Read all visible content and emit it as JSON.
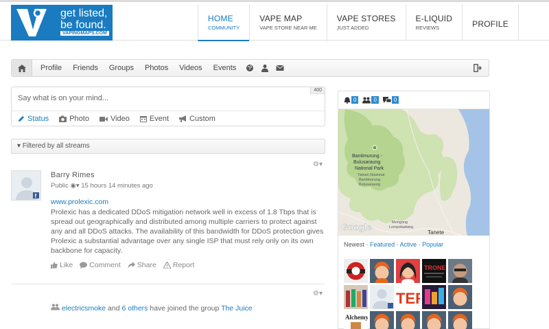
{
  "logo": {
    "tagline_line1": "get listed,",
    "tagline_line2": "be found.",
    "url": "VAPINGMAPS.COM"
  },
  "nav": [
    {
      "main": "HOME",
      "sub": "COMMUNITY"
    },
    {
      "main": "VAPE MAP",
      "sub": "VAPE STORE NEAR ME"
    },
    {
      "main": "VAPE STORES",
      "sub": "JUST ADDED"
    },
    {
      "main": "E-LIQUID",
      "sub": "REVIEWS"
    },
    {
      "main": "PROFILE",
      "sub": ""
    }
  ],
  "toolbar": {
    "links": [
      "Profile",
      "Friends",
      "Groups",
      "Photos",
      "Videos",
      "Events"
    ],
    "icons": [
      "home-icon",
      "globe-icon",
      "user-icon",
      "envelope-icon",
      "logout-icon"
    ]
  },
  "composer": {
    "placeholder": "Say what is on your mind...",
    "counter": "400",
    "tabs": [
      "Status",
      "Photo",
      "Video",
      "Event",
      "Custom"
    ]
  },
  "filter": {
    "label": "Filtered by all streams"
  },
  "post": {
    "author": "Barry Rimes",
    "privacy": "Public",
    "time": "15 hours 14 minutes ago",
    "link": "www.prolexic.com",
    "body": "Prolexic has a dedicated DDoS mitigation network well in excess of 1.8 Tbps that is spread out geographically and distributed among multiple carriers to protect against any and all DDoS attacks. The availability of this bandwidth for DDoS protection gives Prolexic a substantial advantage over any single ISP that must rely only on its own backbone for capacity.",
    "actions": [
      "Like",
      "Comment",
      "Share",
      "Report"
    ]
  },
  "post2": {
    "user": "electricsmoke",
    "and": "and",
    "others": "6 others",
    "text": "have joined the group",
    "group": "The Juice"
  },
  "sidebar": {
    "counts": [
      "0",
      "0",
      "0"
    ],
    "map_labels": {
      "park": "Bantimurung - Bulusaraung National Park",
      "park_local": "Taman Nasional Bantimurung Bulusaraung",
      "town1": "Mongong",
      "town2": "Lompobattang",
      "town3": "Tanete",
      "brand": "Google"
    },
    "member_tabs": {
      "newest": "Newest",
      "featured": "Featured",
      "active": "Active",
      "popular": "Popular",
      "sep": "·"
    }
  },
  "colors": {
    "brand_blue": "#1a7bc0",
    "link_blue": "#1a7bc0"
  }
}
